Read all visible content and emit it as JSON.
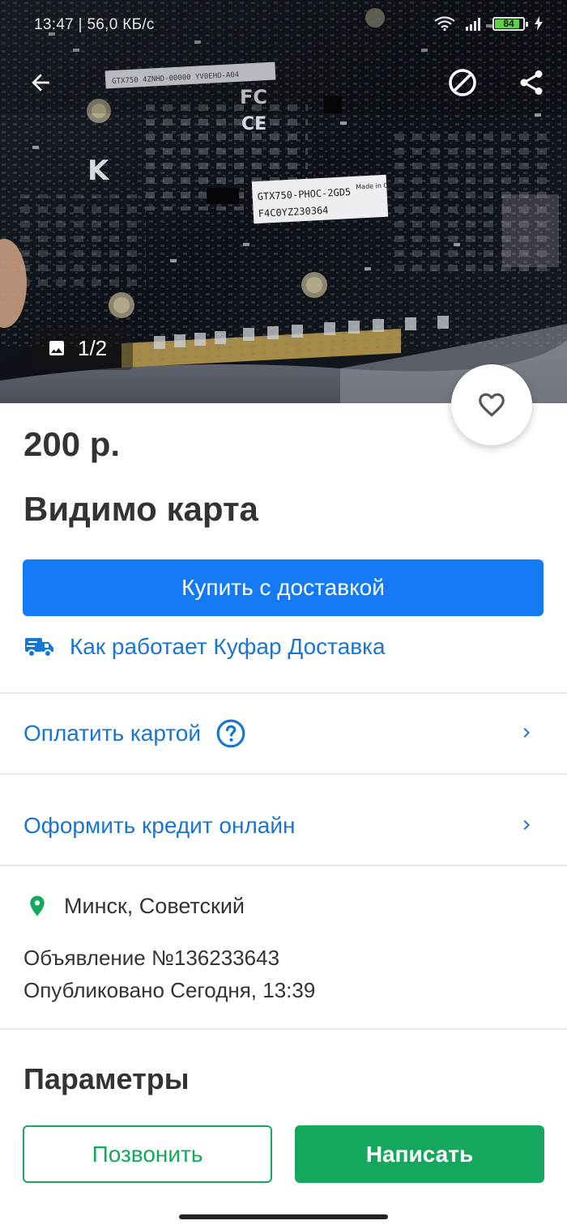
{
  "status_bar": {
    "time": "13:47 | 56,0 КБ/с",
    "battery": "84"
  },
  "hero": {
    "photo_counter": "1/2",
    "board_label_line1": "GTX750-PHOC-2GD5",
    "board_label_line2": "F4C0YZ230364",
    "board_made_in": "Made in China",
    "board_top_sticker": "GTX750 4ZNHD-00000 YV0EHO-A04"
  },
  "listing": {
    "price": "200 р.",
    "title": "Видимо карта",
    "buy_label": "Купить с доставкой",
    "delivery_link": "Как работает Куфар Доставка",
    "pay_card_label": "Оплатить картой",
    "credit_label": "Оформить кредит онлайн",
    "location": "Минск, Советский",
    "ad_number": "Объявление №136233643",
    "published": "Опубликовано Сегодня, 13:39",
    "params_title": "Параметры"
  },
  "actions": {
    "call_label": "Позвонить",
    "write_label": "Написать"
  },
  "colors": {
    "primary_blue": "#1479f5",
    "link_blue": "#1a75d2",
    "green": "#14a85c",
    "text": "#333333"
  },
  "icons": {
    "back": "arrow-left-icon",
    "block": "block-icon",
    "share": "share-icon",
    "image": "image-icon",
    "favorite": "heart-icon",
    "truck": "truck-icon",
    "help": "help-circle-icon",
    "chevron": "chevron-right-icon",
    "location": "location-pin-icon"
  }
}
